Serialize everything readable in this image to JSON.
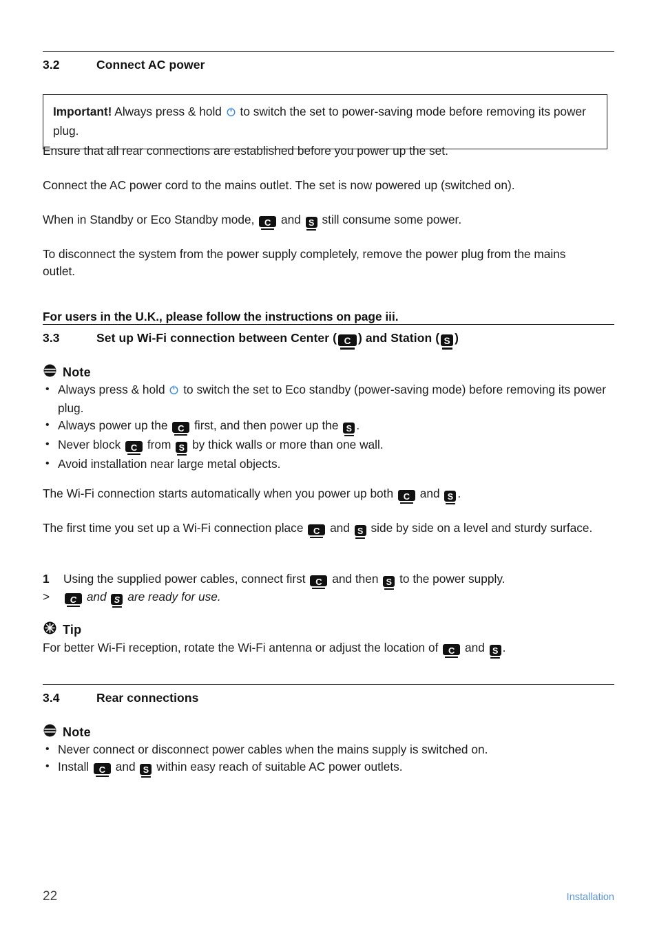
{
  "document": {
    "page_number": "22",
    "footer_label": "Installation",
    "footer_label_color": "#5b93d6",
    "power_icon_color": "#3c86d8"
  },
  "icons": {
    "center": {
      "letter": "C",
      "name": "center-device-icon"
    },
    "station": {
      "letter": "S",
      "name": "station-device-icon"
    },
    "power": "power-standby-icon",
    "note": "note-icon",
    "tip": "tip-icon"
  },
  "sections": {
    "s32": {
      "number": "3.2",
      "title": "Connect AC power",
      "important": {
        "label": "Important!",
        "text_before_icon": "Always press & hold",
        "text_after_icon": "to switch the set to power-saving mode before removing its power plug."
      },
      "para1": "Ensure that all rear connections are established before you power up the set.",
      "para2": "Connect the AC power cord to the mains outlet. The set is now powered up (switched on).",
      "para3_a": "When in Standby or Eco Standby mode,",
      "para3_b": "and",
      "para3_c": "still consume some power.",
      "para4": "To disconnect the system from the power supply completely, remove the power plug from the mains outlet.",
      "uk_notice": "For users in the U.K., please follow the instructions on page iii."
    },
    "s33": {
      "number": "3.3",
      "title_a": "Set up Wi-Fi connection between Center (",
      "title_b": ") and Station (",
      "title_c": ")",
      "note_label": "Note",
      "bullets": [
        {
          "a": "Always press & hold",
          "b": "to switch the set to Eco standby (power-saving mode) before removing its power plug.",
          "icon": "power"
        },
        {
          "a": "Always power up the",
          "b": "first, and then power up the",
          "c": ".",
          "icon": "c-s"
        },
        {
          "a": "Never block",
          "b": "from",
          "c": "by thick walls or more than one wall.",
          "icon": "c-s"
        },
        {
          "a": "Avoid installation near large metal objects.",
          "icon": "none"
        }
      ],
      "para1_a": "The Wi-Fi connection starts automatically when you power up both",
      "para1_b": "and",
      "para1_c": ".",
      "para2_a": "The first time you set up a Wi-Fi connection place",
      "para2_b": "and",
      "para2_c": "side by side on a level and sturdy surface.",
      "step1_marker": "1",
      "step1_a": "Using the supplied power cables, connect first",
      "step1_b": "and then",
      "step1_c": "to the power supply.",
      "step2_marker": ">",
      "step2_a": "and",
      "step2_b": "are ready for use.",
      "tip_label": "Tip",
      "tip_a": "For better Wi-Fi reception, rotate the Wi-Fi antenna or adjust the location of",
      "tip_b": "and",
      "tip_c": "."
    },
    "s34": {
      "number": "3.4",
      "title": "Rear connections",
      "note_label": "Note",
      "bullets": [
        {
          "a": "Never connect or disconnect power cables when the mains supply is switched on.",
          "icon": "none"
        },
        {
          "a": "Install",
          "b": "and",
          "c": "within easy reach of suitable AC power outlets.",
          "icon": "c-s"
        }
      ]
    }
  }
}
